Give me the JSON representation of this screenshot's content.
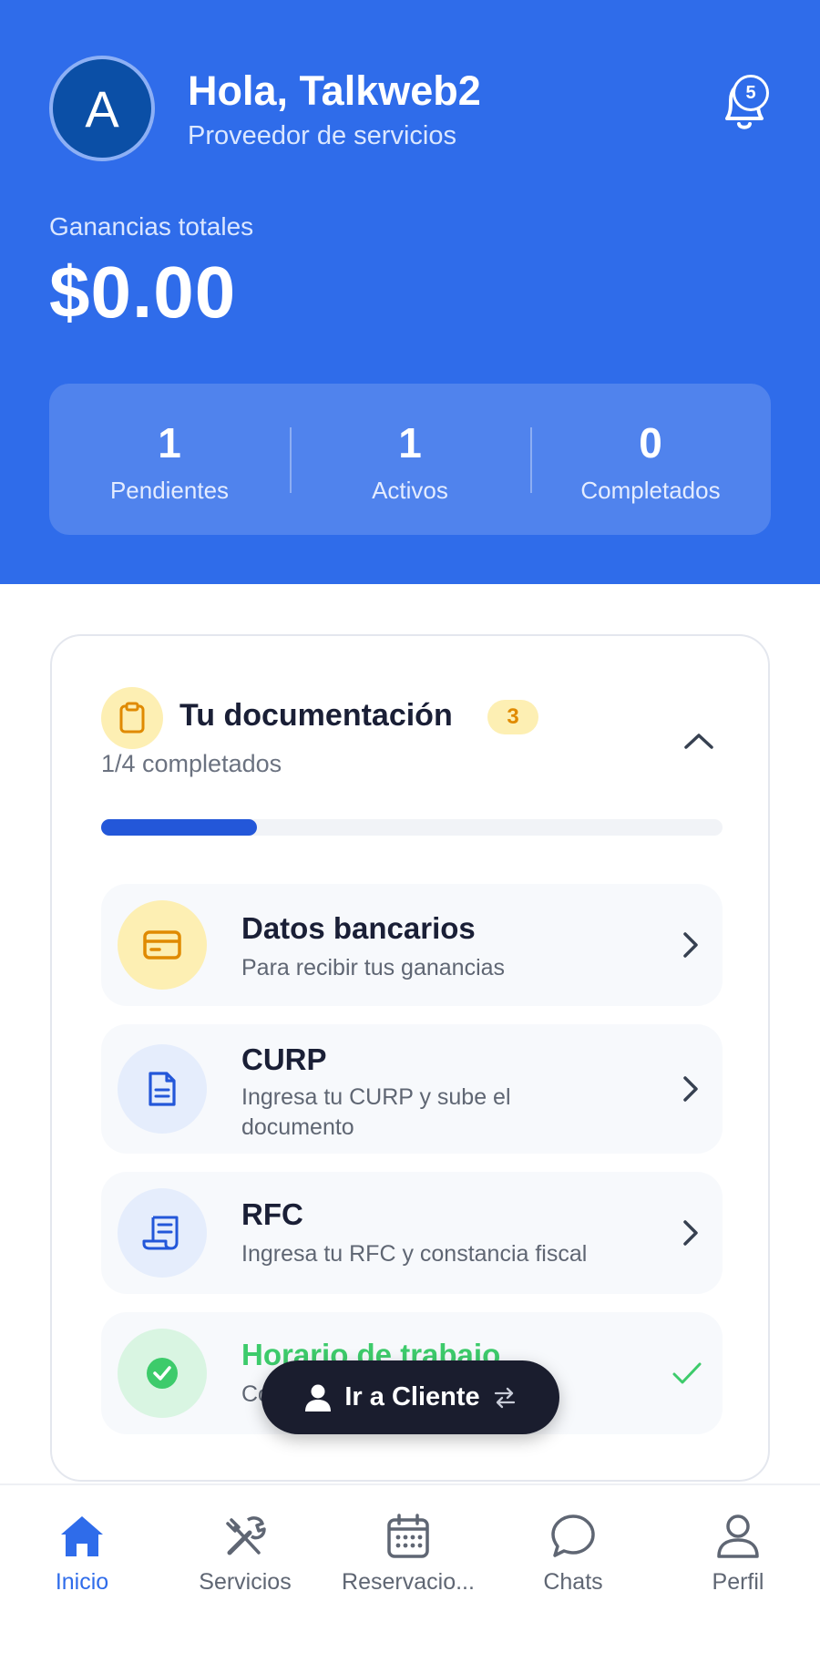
{
  "header": {
    "avatar_initial": "A",
    "greeting": "Hola, Talkweb2",
    "role": "Proveedor de servicios",
    "notifications_count": "5",
    "earnings_label": "Ganancias totales",
    "earnings_value": "$0.00"
  },
  "stats": [
    {
      "value": "1",
      "label": "Pendientes"
    },
    {
      "value": "1",
      "label": "Activos"
    },
    {
      "value": "0",
      "label": "Completados"
    }
  ],
  "documentation": {
    "title": "Tu documentación",
    "pending_badge": "3",
    "progress_text": "1/4 completados",
    "progress_fraction": 0.25,
    "items": [
      {
        "title": "Datos bancarios",
        "subtitle": "Para recibir tus ganancias",
        "icon": "credit-card-icon",
        "status": "pending"
      },
      {
        "title": "CURP",
        "subtitle": "Ingresa tu CURP y sube el documento",
        "icon": "document-icon",
        "status": "pending"
      },
      {
        "title": "RFC",
        "subtitle": "Ingresa tu RFC y constancia fiscal",
        "icon": "receipt-icon",
        "status": "pending"
      },
      {
        "title": "Horario de trabajo",
        "subtitle": "Co",
        "icon": "check-circle-icon",
        "status": "completed"
      }
    ]
  },
  "fab": {
    "label": "Ir a Cliente"
  },
  "tabbar": [
    {
      "label": "Inicio",
      "icon": "home-icon",
      "active": true
    },
    {
      "label": "Servicios",
      "icon": "tools-icon",
      "active": false
    },
    {
      "label": "Reservacio...",
      "icon": "calendar-icon",
      "active": false
    },
    {
      "label": "Chats",
      "icon": "chat-icon",
      "active": false
    },
    {
      "label": "Perfil",
      "icon": "user-icon",
      "active": false
    }
  ],
  "colors": {
    "primary": "#2f6cea",
    "progress": "#2357d9",
    "success": "#3dcb6b",
    "warning_bg": "#fdefb3",
    "warning_text": "#e08a00",
    "dark": "#1a1d2e"
  }
}
